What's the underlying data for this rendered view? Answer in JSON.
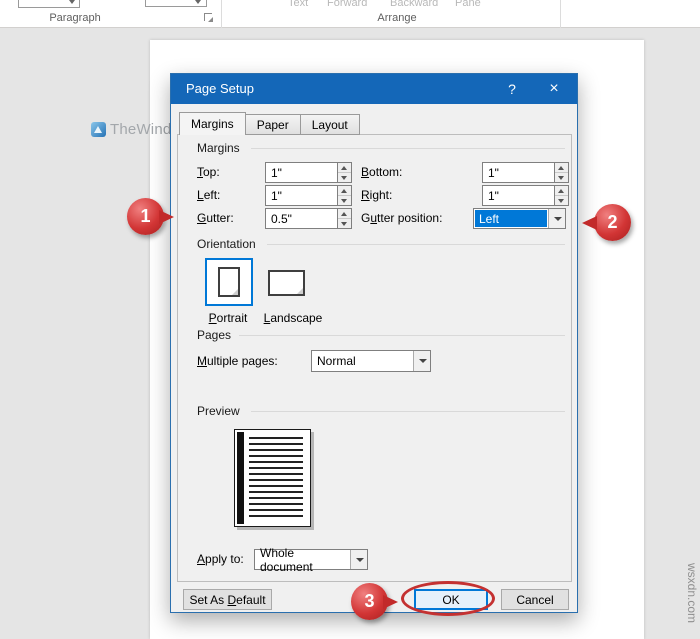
{
  "ribbon": {
    "paragraph_label": "Paragraph",
    "arrange_label": "Arrange",
    "disabled_buttons": [
      "Text",
      "Forward",
      "Backward",
      "Pane"
    ]
  },
  "watermark": {
    "brand": "TheWindowsClub",
    "side_text": "wsxdn.com"
  },
  "dialog": {
    "title": "Page Setup",
    "help_glyph": "?",
    "close_glyph": "×",
    "tabs": [
      "Margins",
      "Paper",
      "Layout"
    ],
    "margins": {
      "group_label": "Margins",
      "top": {
        "label": "Top:",
        "value": "1\""
      },
      "bottom": {
        "label": "Bottom:",
        "value": "1\""
      },
      "left": {
        "label": "Left:",
        "value": "1\""
      },
      "right": {
        "label": "Right:",
        "value": "1\""
      },
      "gutter": {
        "label": "Gutter:",
        "value": "0.5\""
      },
      "gutter_position": {
        "label": "Gutter position:",
        "value": "Left"
      }
    },
    "orientation": {
      "group_label": "Orientation",
      "portrait": "Portrait",
      "landscape": "Landscape"
    },
    "pages": {
      "group_label": "Pages",
      "multiple_pages_label": "Multiple pages:",
      "multiple_pages_value": "Normal"
    },
    "preview": {
      "group_label": "Preview"
    },
    "apply_to": {
      "label": "Apply to:",
      "value": "Whole document"
    },
    "buttons": {
      "set_as_default": "Set As Default",
      "ok": "OK",
      "cancel": "Cancel"
    }
  },
  "annotations": {
    "steps": [
      "1",
      "2",
      "3"
    ]
  }
}
